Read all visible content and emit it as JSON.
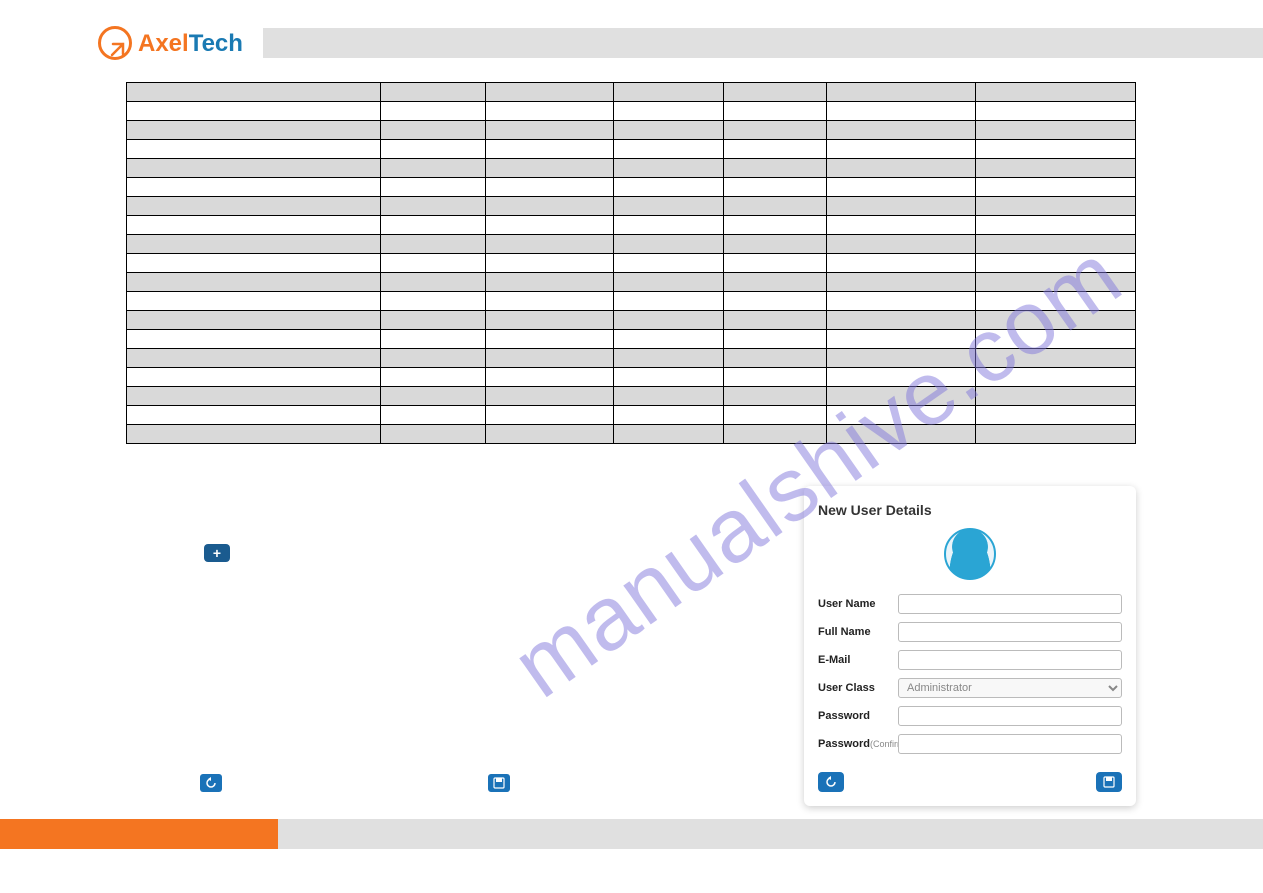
{
  "logo": {
    "axel": "Axel",
    "tech": "Tech"
  },
  "watermark": "manualshive.com",
  "add_label": "+",
  "panel": {
    "title": "New User Details",
    "user_name_label": "User Name",
    "full_name_label": "Full Name",
    "email_label": "E-Mail",
    "user_class_label": "User Class",
    "user_class_value": "Administrator",
    "password_label": "Password",
    "password_confirm_label": "Password",
    "password_confirm_suffix": "(Confirm)"
  },
  "table": {
    "rows": 19,
    "cols": 7
  }
}
